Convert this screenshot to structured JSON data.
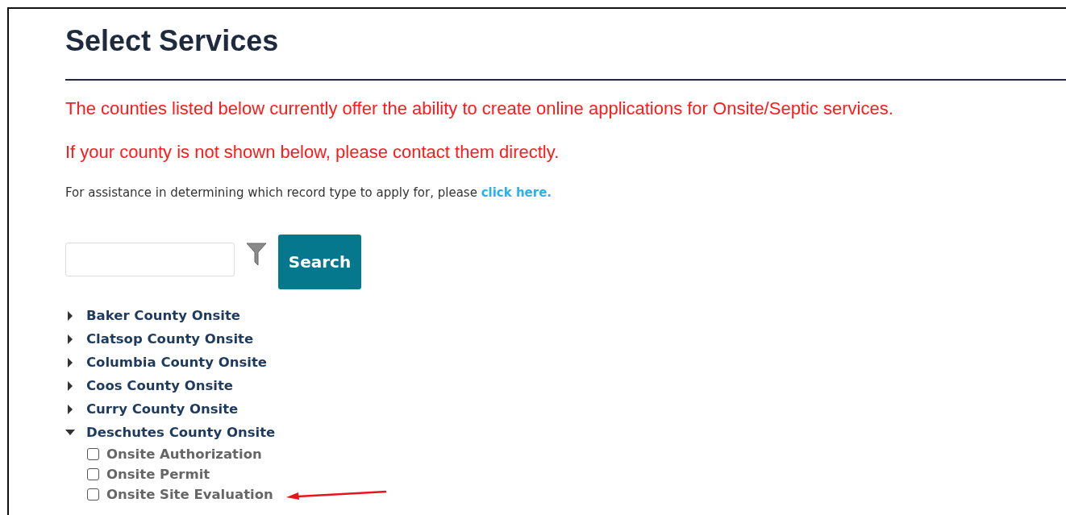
{
  "title": "Select Services",
  "notices": [
    "The counties listed below currently offer the ability to create online applications for Onsite/Septic services.",
    "If your county is not shown below, please contact them directly."
  ],
  "assistance": {
    "text": "For assistance in determining which record type to apply for, please",
    "link": "click here."
  },
  "search": {
    "button": "Search"
  },
  "tree": [
    {
      "label": "Baker County Onsite",
      "expanded": false
    },
    {
      "label": "Clatsop County Onsite",
      "expanded": false
    },
    {
      "label": "Columbia County Onsite",
      "expanded": false
    },
    {
      "label": "Coos County Onsite",
      "expanded": false
    },
    {
      "label": "Curry County Onsite",
      "expanded": false
    },
    {
      "label": "Deschutes County Onsite",
      "expanded": true,
      "children": [
        {
          "label": "Onsite Authorization",
          "checked": false
        },
        {
          "label": "Onsite Permit",
          "checked": false
        },
        {
          "label": "Onsite Site Evaluation",
          "checked": false
        }
      ]
    }
  ]
}
